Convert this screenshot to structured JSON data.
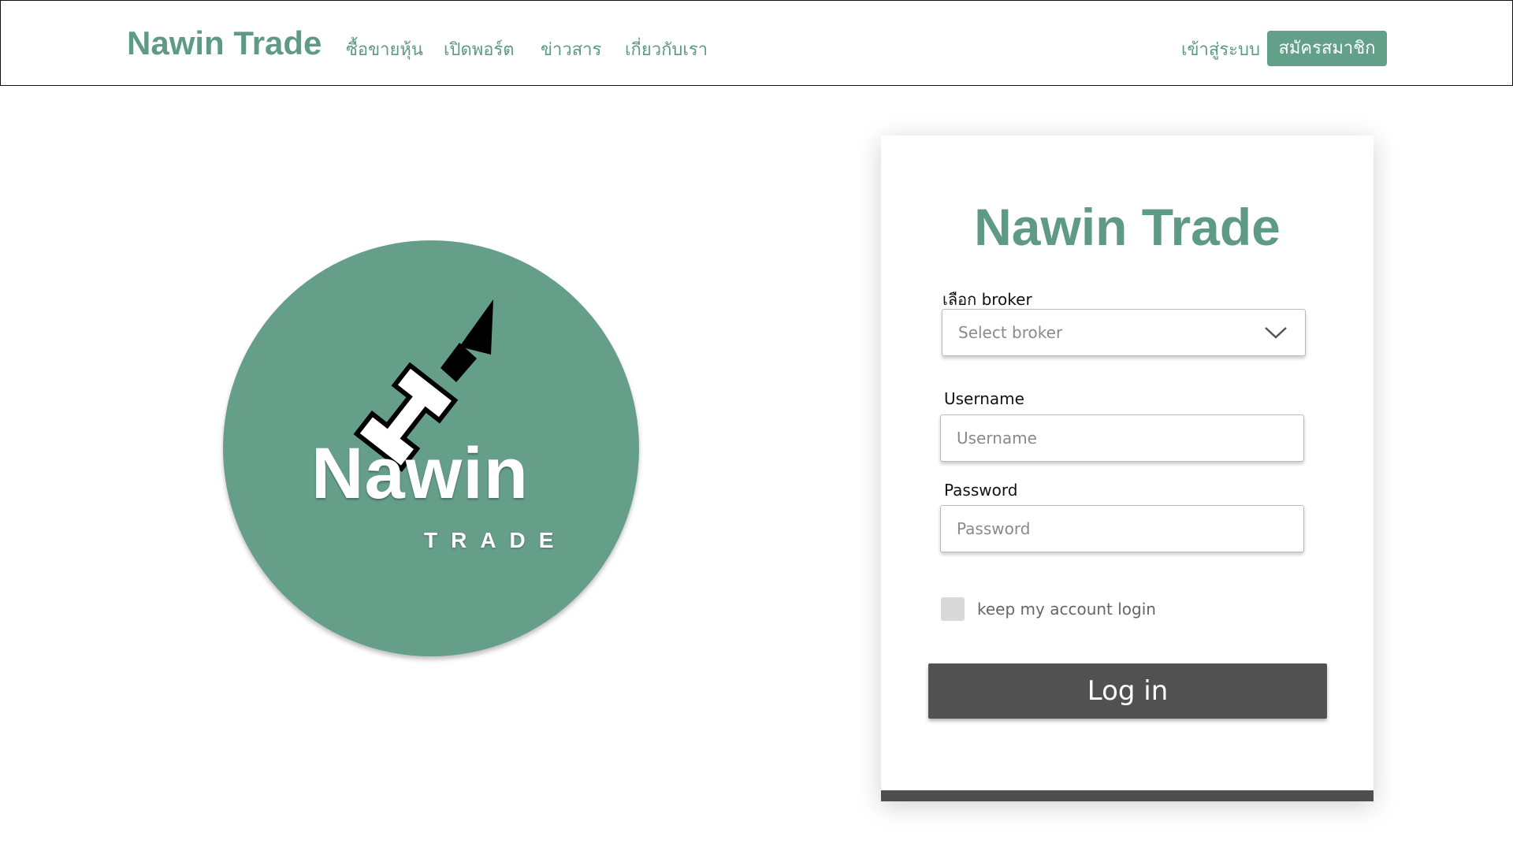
{
  "nav": {
    "brand": "Nawin Trade",
    "links": [
      "ซื้อขายหุ้น",
      "เปิดพอร์ต",
      "ข่าวสาร",
      "เกี่ยวกับเรา"
    ],
    "login_label": "เข้าสู่ระบบ",
    "signup_label": "สมัครสมาชิก"
  },
  "logo": {
    "word": "Nawin",
    "sub": "TRADE",
    "icon": "n-arrow-up-icon"
  },
  "login": {
    "title": "Nawin Trade",
    "broker_label": "เลือก broker",
    "broker_placeholder": "Select broker",
    "username_label": "Username",
    "username_placeholder": "Username",
    "password_label": "Password",
    "password_placeholder": "Password",
    "remember_label": "keep my account login",
    "remember_checked": false,
    "submit_label": "Log in"
  },
  "colors": {
    "brand_green": "#5e9a86",
    "logo_green": "#659e89",
    "button_dark": "#515151"
  }
}
